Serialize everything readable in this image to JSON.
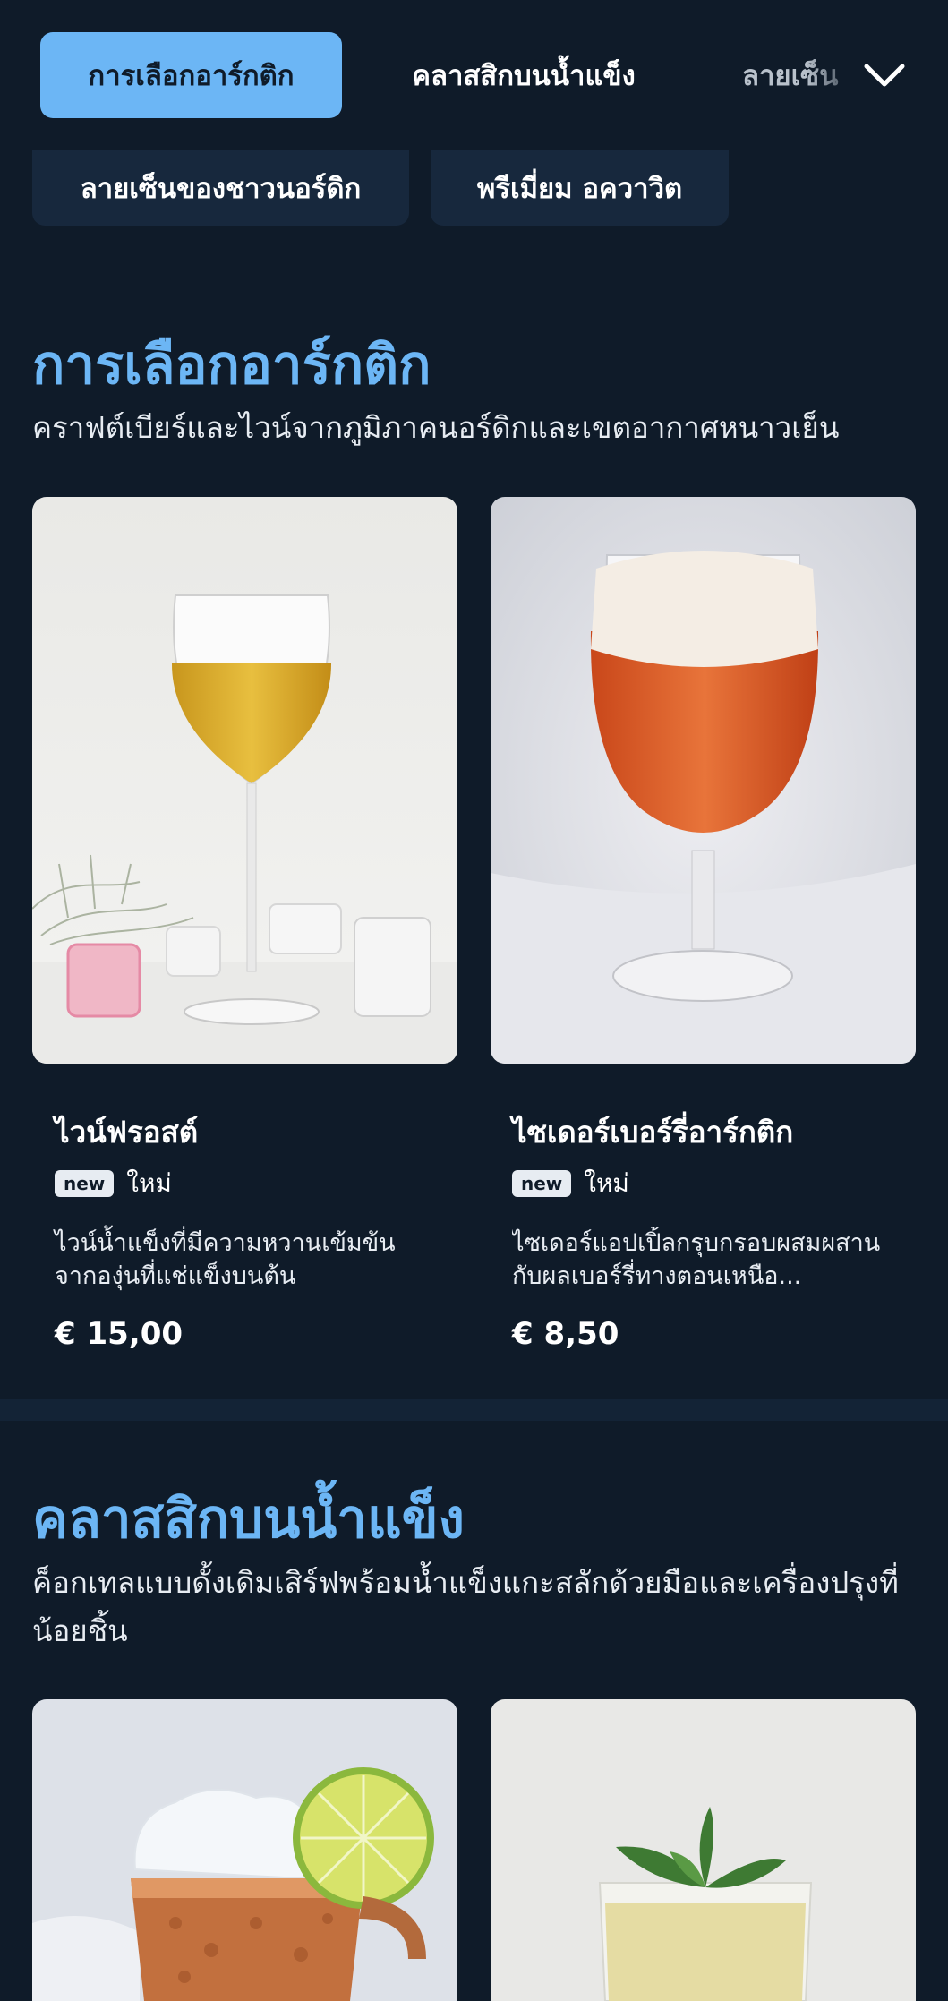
{
  "nav": {
    "tabs": [
      {
        "label": "การเลือกอาร์กติก",
        "active": true
      },
      {
        "label": "คลาสสิกบนน้ำแข็ง",
        "active": false
      },
      {
        "label": "ลายเซ็น",
        "active": false
      }
    ],
    "chips": [
      {
        "label": "ลายเซ็นของชาวนอร์ดิก"
      },
      {
        "label": "พรีเมี่ยม อควาวิต"
      }
    ],
    "more_icon": "chevron-down-icon"
  },
  "sections": [
    {
      "title": "การเลือกอาร์กติก",
      "description": "คราฟต์เบียร์และไวน์จากภูมิภาคนอร์ดิกและเขตอากาศหนาวเย็น",
      "items": [
        {
          "name": "ไวน์ฟรอสต์",
          "badge": "new",
          "badge_text": "ใหม่",
          "description": "ไวน์น้ำแข็งที่มีความหวานเข้มข้นจากองุ่นที่แช่แข็งบนต้น",
          "price": "€ 15,00"
        },
        {
          "name": "ไซเดอร์เบอร์รี่อาร์กติก",
          "badge": "new",
          "badge_text": "ใหม่",
          "description": "ไซเดอร์แอปเปิ้ลกรุบกรอบผสมผสานกับผลเบอร์รี่ทางตอนเหนือ...",
          "price": "€ 8,50"
        }
      ]
    },
    {
      "title": "คลาสสิกบนน้ำแข็ง",
      "description": "ค็อกเทลแบบดั้งเดิมเสิร์ฟพร้อมน้ำแข็งแกะสลักด้วยมือและเครื่องปรุงที่น้อยชิ้น",
      "items": []
    }
  ],
  "colors": {
    "background": "#0f1b29",
    "accent": "#6cb6f5",
    "chip": "#17283d"
  }
}
